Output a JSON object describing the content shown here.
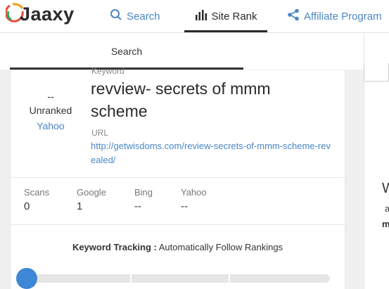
{
  "brand": {
    "name": "Jaaxy"
  },
  "nav": {
    "search_label": "Search",
    "siterank_label": "Site Rank",
    "affiliate_label": "Affiliate Program"
  },
  "subtabs": {
    "search_label": "Search"
  },
  "result": {
    "rank_value": "--",
    "rank_status": "Unranked",
    "rank_engine": "Yahoo",
    "keyword_label": "Keyword",
    "keyword_value": "revview- secrets of mmm scheme",
    "url_label": "URL",
    "url_value": "http://getwisdoms.com/review-secrets-of-mmm-scheme-revealed/"
  },
  "stats": [
    {
      "label": "Scans",
      "value": "0"
    },
    {
      "label": "Google",
      "value": "1"
    },
    {
      "label": "Bing",
      "value": "--"
    },
    {
      "label": "Yahoo",
      "value": "--"
    }
  ],
  "tracking": {
    "label": "Keyword Tracking :",
    "value": "Automatically Follow Rankings"
  },
  "slider": {
    "level": 0
  },
  "right_panel": {
    "line1": "W",
    "line2": "a",
    "line3": "m"
  },
  "colors": {
    "accent": "#4a86c5",
    "knob": "#3e86d6"
  },
  "icons": {
    "search": "search-icon",
    "siterank": "bar-chart-icon",
    "affiliate": "share-icon"
  }
}
